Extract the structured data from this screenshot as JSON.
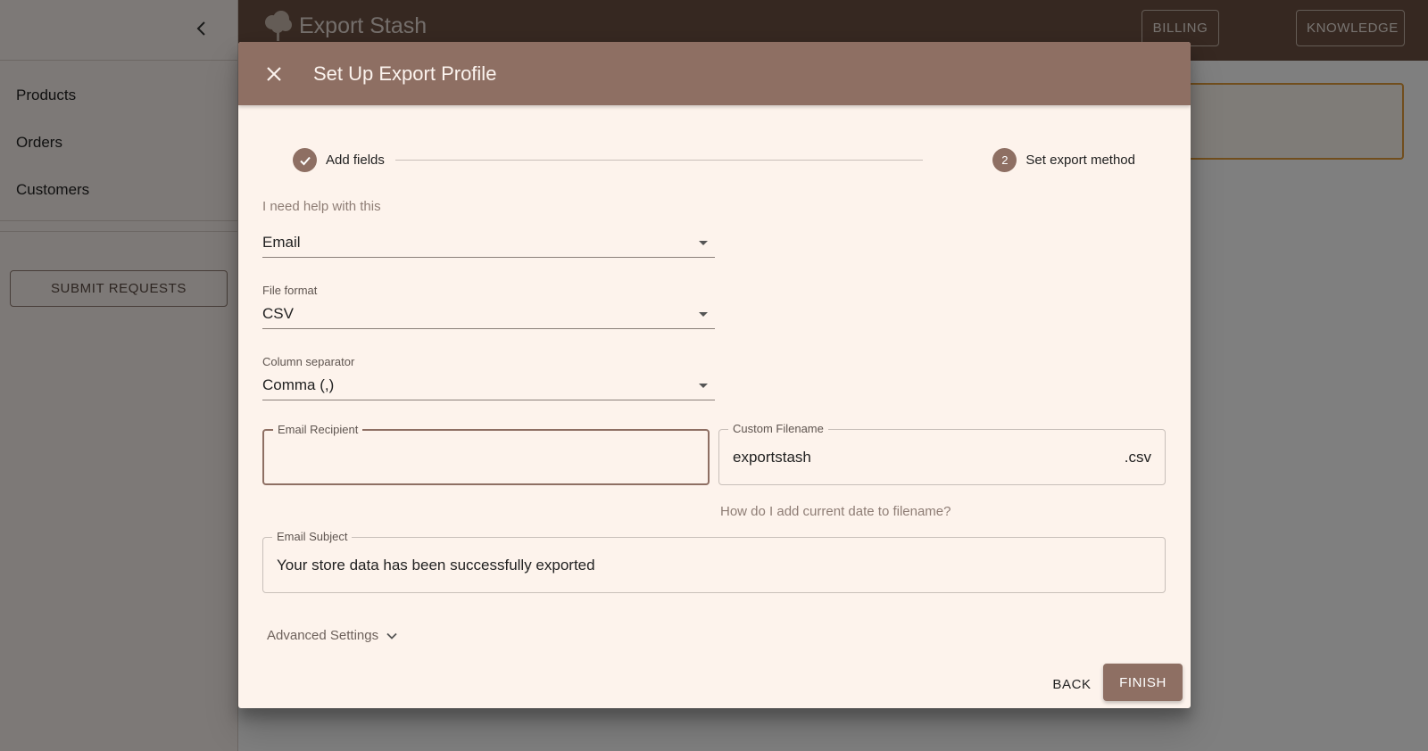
{
  "app": {
    "name": "Export Stash",
    "colors": {
      "header": "#6d5142",
      "accent": "#8e6f63",
      "modal_bg": "#fdf3ec",
      "highlight_border": "#e29d3a"
    }
  },
  "topbar": {
    "billing_label": "BILLING",
    "knowledge_label": "KNOWLEDGE"
  },
  "sidebar": {
    "items": [
      {
        "label": "Products"
      },
      {
        "label": "Orders"
      },
      {
        "label": "Customers"
      }
    ],
    "submit_label": "SUBMIT REQUESTS"
  },
  "modal": {
    "title": "Set Up Export Profile",
    "steps": [
      {
        "label": "Add fields",
        "status": "completed",
        "icon": "check-icon"
      },
      {
        "label": "Set export method",
        "status": "active",
        "number": "2"
      }
    ],
    "help_link": "I need help with this",
    "export_method": {
      "label": "",
      "value": "Email"
    },
    "file_format": {
      "label": "File format",
      "value": "CSV"
    },
    "column_separator": {
      "label": "Column separator",
      "value": "Comma (,)"
    },
    "email_recipient": {
      "label": "Email Recipient",
      "value": ""
    },
    "custom_filename": {
      "label": "Custom Filename",
      "value": "exportstash",
      "suffix": ".csv"
    },
    "filename_help": "How do I add current date to filename?",
    "email_subject": {
      "label": "Email Subject",
      "value": "Your store data has been successfully exported"
    },
    "advanced_settings": "Advanced Settings",
    "back_label": "BACK",
    "finish_label": "FINISH"
  }
}
